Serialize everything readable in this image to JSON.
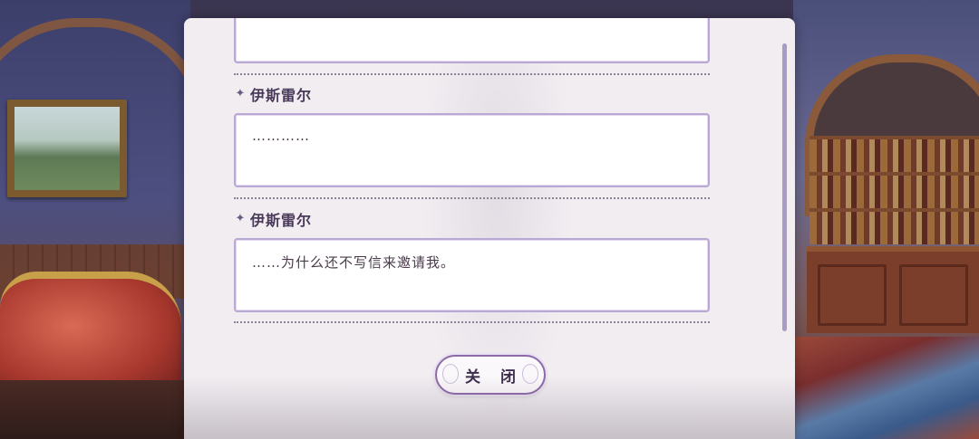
{
  "dialog": {
    "entries": [
      {
        "speaker": "",
        "text": ""
      },
      {
        "speaker": "伊斯雷尔",
        "text": "…………"
      },
      {
        "speaker": "伊斯雷尔",
        "text": "……为什么还不写信来邀请我。"
      }
    ],
    "close_label": "关 闭"
  },
  "icons": {
    "speaker_marker": "four-point-star-icon"
  },
  "colors": {
    "panel_bg": "#f1edf1",
    "box_border": "#b9a8d3",
    "button_border": "#8c6aa8",
    "scrollbar": "#a89cc4",
    "name_text": "#4a3a5a"
  }
}
